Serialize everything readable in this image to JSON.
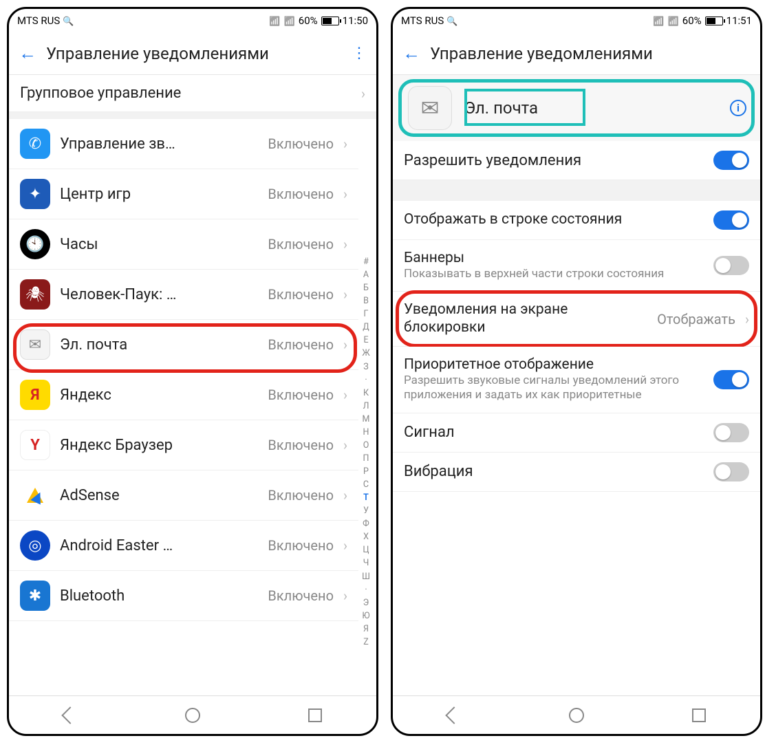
{
  "left": {
    "status": {
      "carrier": "MTS RUS",
      "battery": "60%",
      "time": "11:50"
    },
    "title": "Управление уведомлениями",
    "group_row": "Групповое управление",
    "apps": [
      {
        "name": "Управление зв…",
        "status": "Включено"
      },
      {
        "name": "Центр игр",
        "status": "Включено"
      },
      {
        "name": "Часы",
        "status": "Включено"
      },
      {
        "name": "Человек-Паук: …",
        "status": "Включено"
      },
      {
        "name": "Эл. почта",
        "status": "Включено"
      },
      {
        "name": "Яндекс",
        "status": "Включено"
      },
      {
        "name": "Яндекс Браузер",
        "status": "Включено"
      },
      {
        "name": "AdSense",
        "status": "Включено"
      },
      {
        "name": "Android Easter …",
        "status": "Включено"
      },
      {
        "name": "Bluetooth",
        "status": "Включено"
      }
    ],
    "index": [
      "#",
      "А",
      "Б",
      "В",
      "Г",
      "Д",
      "Е",
      "Ж",
      "З",
      "·",
      "К",
      "Л",
      "М",
      "Н",
      "О",
      "П",
      "Р",
      "С",
      "Т",
      "У",
      "Ф",
      "Х",
      "Ц",
      "Ч",
      "Ш",
      "·",
      "Э",
      "Ю",
      "Я",
      "Z"
    ]
  },
  "right": {
    "status": {
      "carrier": "MTS RUS",
      "battery": "60%",
      "time": "11:51"
    },
    "title": "Управление уведомлениями",
    "app_name": "Эл. почта",
    "rows": {
      "allow": {
        "label": "Разрешить уведомления",
        "on": true
      },
      "statusbar": {
        "label": "Отображать в строке состояния",
        "on": true
      },
      "banners": {
        "label": "Баннеры",
        "sub": "Показывать в верхней части строки состояния",
        "on": false
      },
      "lockscreen": {
        "label": "Уведомления на экране блокировки",
        "value": "Отображать"
      },
      "priority": {
        "label": "Приоритетное отображение",
        "sub": "Разрешить звуковые сигналы уведомлений этого приложения и задать их как приоритетные",
        "on": true
      },
      "sound": {
        "label": "Сигнал",
        "on": false
      },
      "vibration": {
        "label": "Вибрация",
        "on": false
      }
    }
  }
}
